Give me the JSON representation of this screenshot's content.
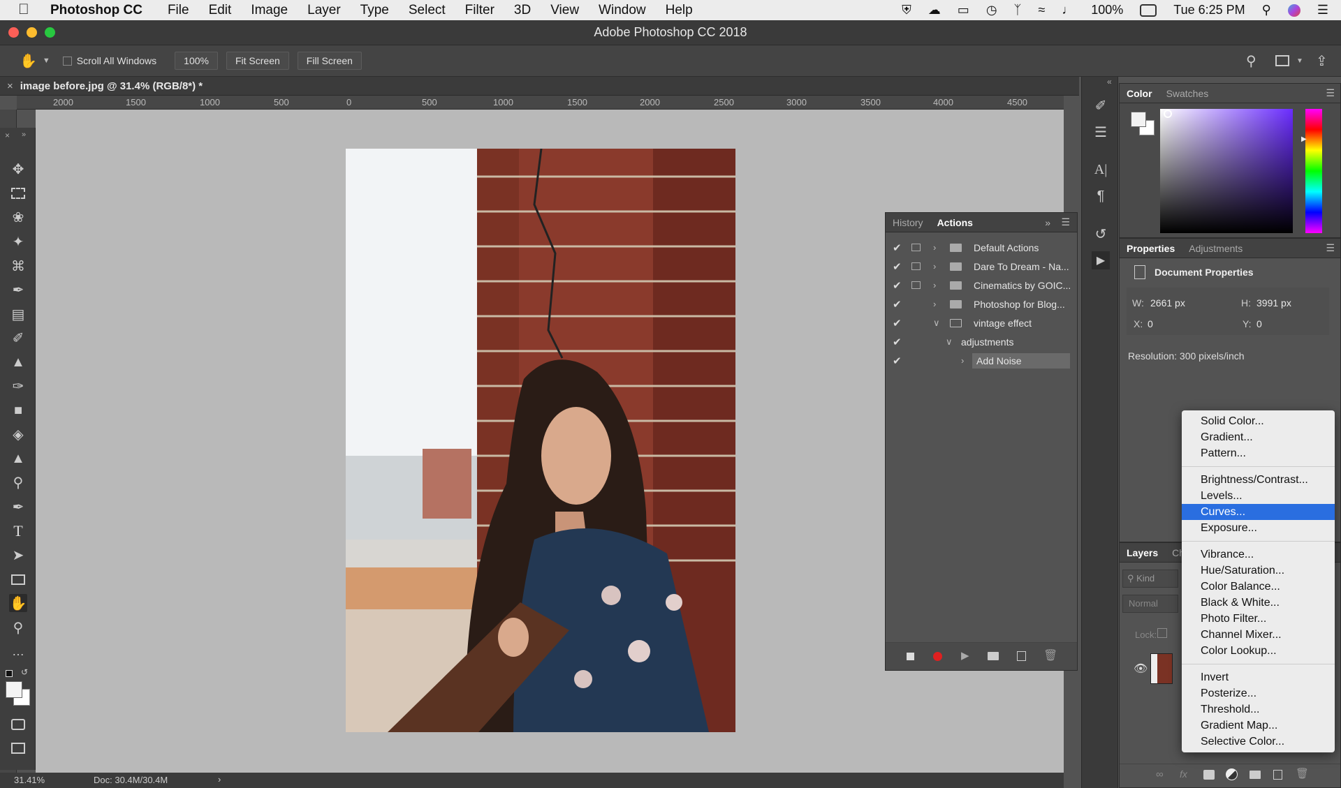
{
  "menubar": {
    "app": "Photoshop CC",
    "items": [
      "File",
      "Edit",
      "Image",
      "Layer",
      "Type",
      "Select",
      "Filter",
      "3D",
      "View",
      "Window",
      "Help"
    ],
    "battery": "100%",
    "clock": "Tue 6:25 PM"
  },
  "window": {
    "title": "Adobe Photoshop CC 2018"
  },
  "options": {
    "scroll_all": "Scroll All Windows",
    "zoom": "100%",
    "fit": "Fit Screen",
    "fill": "Fill Screen"
  },
  "document": {
    "tab": "image before.jpg @ 31.4% (RGB/8*) *"
  },
  "ruler": {
    "ticks": [
      "2000",
      "1500",
      "1000",
      "500",
      "0",
      "500",
      "1000",
      "1500",
      "2000",
      "2500",
      "3000",
      "3500",
      "4000",
      "4500"
    ]
  },
  "statusbar": {
    "zoom": "31.41%",
    "doc": "Doc: 30.4M/30.4M"
  },
  "actions_panel": {
    "tabs": [
      "History",
      "Actions"
    ],
    "rows": [
      {
        "label": "Default Actions",
        "checked": true,
        "toggle": true,
        "expanded": false,
        "type": "set"
      },
      {
        "label": "Dare To Dream - Na...",
        "checked": true,
        "toggle": true,
        "expanded": false,
        "type": "set"
      },
      {
        "label": "Cinematics by GOIC...",
        "checked": true,
        "toggle": true,
        "expanded": false,
        "type": "set"
      },
      {
        "label": "Photoshop for Blog...",
        "checked": true,
        "toggle": false,
        "expanded": false,
        "type": "set"
      },
      {
        "label": "vintage effect",
        "checked": true,
        "toggle": false,
        "expanded": true,
        "type": "set"
      },
      {
        "label": "adjustments",
        "checked": true,
        "toggle": false,
        "expanded": true,
        "type": "action"
      },
      {
        "label": "Add Noise",
        "checked": true,
        "toggle": false,
        "expanded": false,
        "type": "step",
        "selected": true
      }
    ]
  },
  "color_panel": {
    "tabs": [
      "Color",
      "Swatches"
    ]
  },
  "properties_panel": {
    "tabs": [
      "Properties",
      "Adjustments"
    ],
    "title": "Document Properties",
    "w_label": "W:",
    "w": "2661 px",
    "h_label": "H:",
    "h": "3991 px",
    "x_label": "X:",
    "x": "0",
    "y_label": "Y:",
    "y": "0",
    "resolution": "Resolution: 300 pixels/inch"
  },
  "layers_panel": {
    "tabs": [
      "Layers",
      "Ch"
    ],
    "kind_placeholder": "Kind",
    "blend": "Normal",
    "lock": "Lock:"
  },
  "context_menu": {
    "groups": [
      [
        "Solid Color...",
        "Gradient...",
        "Pattern..."
      ],
      [
        "Brightness/Contrast...",
        "Levels...",
        "Curves...",
        "Exposure..."
      ],
      [
        "Vibrance...",
        "Hue/Saturation...",
        "Color Balance...",
        "Black & White...",
        "Photo Filter...",
        "Channel Mixer...",
        "Color Lookup..."
      ],
      [
        "Invert",
        "Posterize...",
        "Threshold...",
        "Gradient Map...",
        "Selective Color..."
      ]
    ],
    "selected": "Curves..."
  },
  "colors": {
    "accent": "#2a6ee0",
    "record": "#e02020"
  }
}
